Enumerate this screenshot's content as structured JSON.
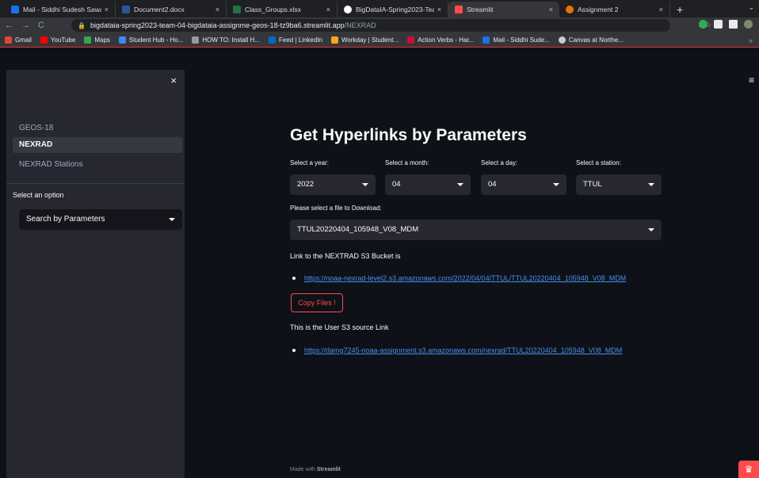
{
  "browser": {
    "tabs": [
      {
        "title": "Mail - Siddhi Sudesh Sawa",
        "color": "#1a73e8"
      },
      {
        "title": "Document2.docx",
        "color": "#2b579a"
      },
      {
        "title": "Class_Groups.xlsx",
        "color": "#217346"
      },
      {
        "title": "BigDataIA-Spring2023-Tea",
        "color": "#ffffff"
      },
      {
        "title": "Streamlit",
        "color": "#ff4b4b"
      },
      {
        "title": "Assignment 2",
        "color": "#e8710a"
      }
    ],
    "new_tab": "+",
    "url_host": "bigdataia-spring2023-team-04-bigdataia-assignme-geos-18-tz9ba6.streamlit.app",
    "url_path": "/NEXRAD",
    "bookmarks": [
      {
        "label": "Gmail",
        "color": "#ea4335"
      },
      {
        "label": "YouTube",
        "color": "#ff0000"
      },
      {
        "label": "Maps",
        "color": "#34a853"
      },
      {
        "label": "Student Hub - Ho...",
        "color": "#4285f4"
      },
      {
        "label": "HOW TO: Install H...",
        "color": "#999999"
      },
      {
        "label": "Feed | LinkedIn",
        "color": "#0a66c2"
      },
      {
        "label": "Workday | Student...",
        "color": "#f5a623"
      },
      {
        "label": "Action Verbs - Har...",
        "color": "#c41230"
      },
      {
        "label": "Mail - Siddhi Sude...",
        "color": "#1a73e8"
      },
      {
        "label": "Canvas at Northe...",
        "color": "#cccccc"
      }
    ],
    "bookmarks_more": "»"
  },
  "sidebar": {
    "close": "×",
    "nav": [
      "GEOS-18",
      "NEXRAD",
      "NEXRAD Stations"
    ],
    "active_index": 1,
    "option_label": "Select an option",
    "option_value": "Search by Parameters"
  },
  "main": {
    "title": "Get Hyperlinks by Parameters",
    "filters": [
      {
        "label": "Select a year:",
        "value": "2022"
      },
      {
        "label": "Select a month:",
        "value": "04"
      },
      {
        "label": "Select a day:",
        "value": "04"
      },
      {
        "label": "Select a station:",
        "value": "TTUL"
      }
    ],
    "file_label": "Please select a file to Download:",
    "file_value": "TTUL20220404_105948_V08_MDM",
    "bucket_text": "Link to the NEXTRAD S3 Bucket is",
    "bucket_link": "https://noaa-nexrad-level2.s3.amazonaws.com/2022/04/04/TTUL/TTUL20220404_105948_V08_MDM",
    "copy_button": "Copy Files !",
    "user_text": "This is the User S3 source Link",
    "user_link": "https://damg7245-noaa-assignment.s3.amazonaws.com/nexrad/TTUL20220404_105948_V08_MDM",
    "footer_prefix": "Made with",
    "footer_brand": "Streamlit"
  }
}
